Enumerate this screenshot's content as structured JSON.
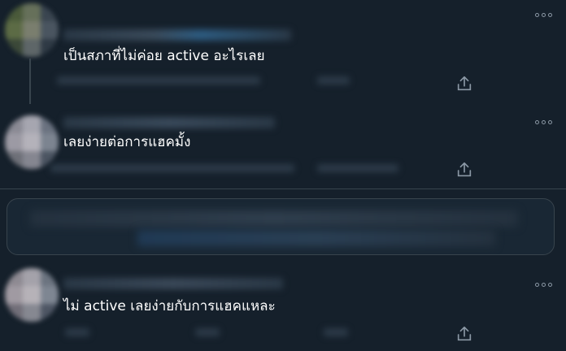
{
  "replies": [
    {
      "content": "เป็นสภาที่ไม่ค่อย active อะไรเลย"
    },
    {
      "content": "เลยง่ายต่อการแฮคมั้ง"
    },
    {
      "content": "ไม่ active เลยง่ายกับการแฮคแหละ"
    }
  ],
  "icons": {
    "more": "more-horizontal-icon",
    "share": "share-icon"
  },
  "colors": {
    "background": "#15202b",
    "divider": "#38444d",
    "icon": "#8b98a5",
    "text": "#ffffff"
  }
}
